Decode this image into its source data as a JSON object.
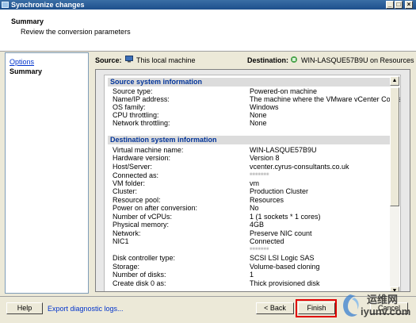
{
  "window": {
    "title": "Synchronize changes"
  },
  "header": {
    "title": "Summary",
    "subtitle": "Review the conversion parameters"
  },
  "nav": {
    "items": [
      {
        "label": "Options",
        "link": true
      },
      {
        "label": "Summary",
        "current": true
      }
    ]
  },
  "source": {
    "label": "Source:",
    "value": "This local machine"
  },
  "destination": {
    "label": "Destination:",
    "value": "WIN-LASQUE57B9U on Resources"
  },
  "sections": [
    {
      "title": "Source system information",
      "rows": [
        {
          "key": "Source type:",
          "value": "Powered-on machine"
        },
        {
          "key": "Name/IP address:",
          "value": "The machine where the VMware vCenter Converter St"
        },
        {
          "key": "OS family:",
          "value": "Windows"
        },
        {
          "key": "CPU throttling:",
          "value": "None"
        },
        {
          "key": "Network throttling:",
          "value": "None"
        }
      ]
    },
    {
      "title": "Destination system information",
      "rows": [
        {
          "key": "Virtual machine name:",
          "value": "WIN-LASQUE57B9U"
        },
        {
          "key": "Hardware version:",
          "value": "Version 8"
        },
        {
          "key": "Host/Server:",
          "value": "vcenter.cyrus-consultants.co.uk"
        },
        {
          "key": "Connected as:",
          "value": "*******"
        },
        {
          "key": "VM folder:",
          "value": "vm"
        },
        {
          "key": "Cluster:",
          "value": "Production Cluster"
        },
        {
          "key": "Resource pool:",
          "value": "Resources"
        },
        {
          "key": "Power on after conversion:",
          "value": "No"
        },
        {
          "key": "Number of vCPUs:",
          "value": "1 (1 sockets * 1 cores)"
        },
        {
          "key": "Physical memory:",
          "value": "4GB"
        },
        {
          "key": "Network:",
          "value": "Preserve NIC count"
        },
        {
          "key": "NIC1",
          "value": "Connected"
        },
        {
          "key": "",
          "value": "*******"
        },
        {
          "key": "Disk controller type:",
          "value": "SCSI LSI Logic SAS"
        },
        {
          "key": "Storage:",
          "value": "Volume-based cloning"
        },
        {
          "key": "Number of disks:",
          "value": "1"
        },
        {
          "key": "Create disk 0 as:",
          "value": "Thick provisioned disk"
        }
      ]
    }
  ],
  "footer": {
    "help": "Help",
    "export": "Export diagnostic logs...",
    "back": "< Back",
    "finish": "Finish",
    "cancel": "Cancel"
  },
  "watermark": {
    "line1": "运维网",
    "line2": "iyunv.com"
  }
}
